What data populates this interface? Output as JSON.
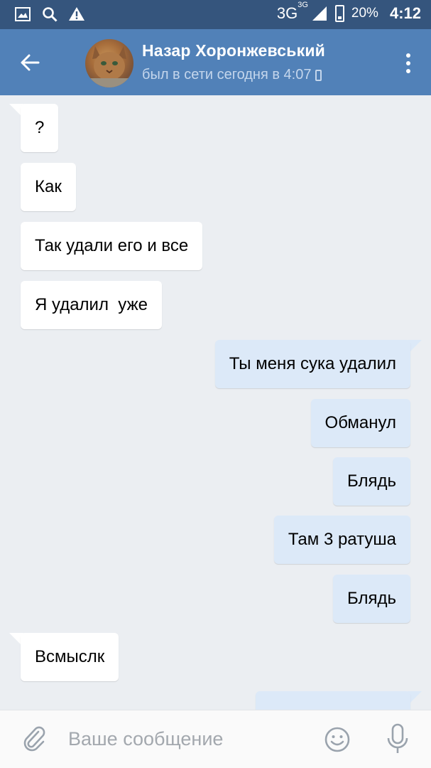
{
  "status_bar": {
    "network": "3G",
    "network_sup": "3G",
    "battery": "20%",
    "time": "4:12",
    "icons": [
      "gallery-icon",
      "search-icon",
      "warning-icon",
      "signal-icon",
      "battery-icon"
    ]
  },
  "header": {
    "name": "Назар Хоронжевський",
    "status": "был в сети сегодня в 4:07"
  },
  "messages": [
    {
      "dir": "in",
      "text": "?"
    },
    {
      "dir": "in",
      "text": "Как"
    },
    {
      "dir": "in",
      "text": "Так удали его и все"
    },
    {
      "dir": "in",
      "text": "Я удалил  уже"
    },
    {
      "dir": "out",
      "text": "Ты меня сука удалил"
    },
    {
      "dir": "out",
      "text": "Обманул"
    },
    {
      "dir": "out",
      "text": "Блядь"
    },
    {
      "dir": "out",
      "text": "Там 3 ратуша"
    },
    {
      "dir": "out",
      "text": "Блядь"
    },
    {
      "dir": "in",
      "text": "Всмыслк"
    }
  ],
  "input": {
    "placeholder": "Ваше сообщение",
    "value": ""
  },
  "colors": {
    "status_bar": "#35557d",
    "header": "#5181b8",
    "background": "#ebeef2",
    "incoming": "#ffffff",
    "outgoing": "#dce9f8"
  }
}
